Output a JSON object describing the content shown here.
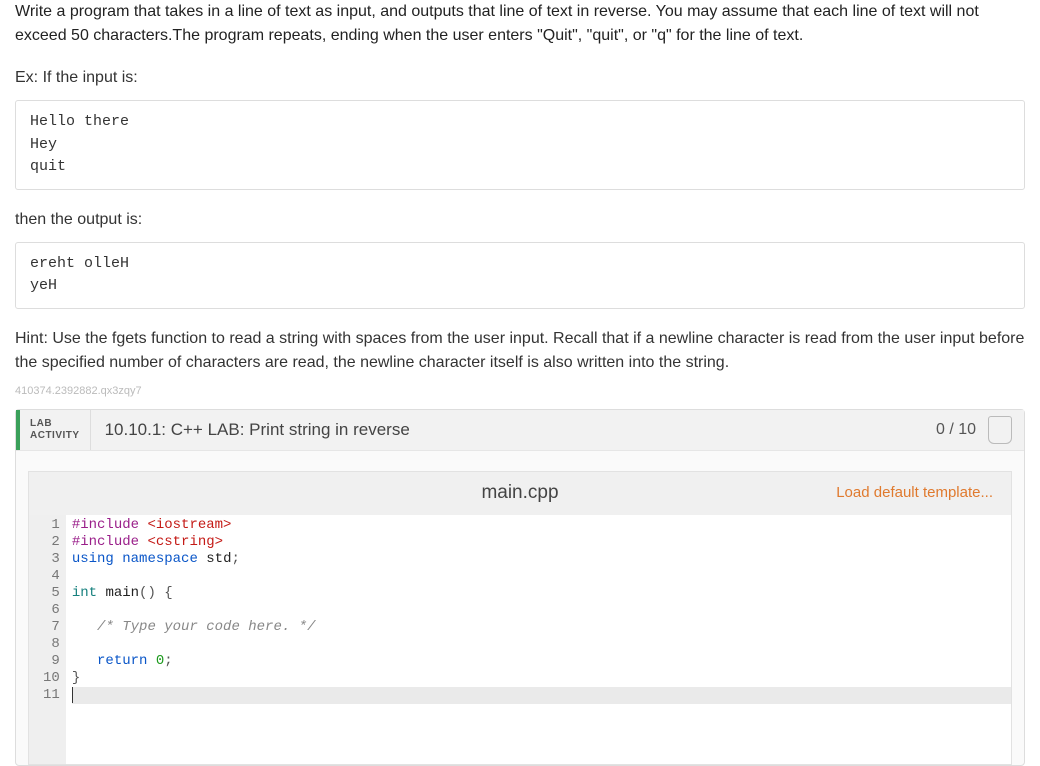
{
  "problem": {
    "description": "Write a program that takes in a line of text as input, and outputs that line of text in reverse. You may assume that each line of text will not exceed 50 characters.The program repeats, ending when the user enters \"Quit\", \"quit\", or \"q\" for the line of text.",
    "ex_label": "Ex: If the input is:",
    "input_example": "Hello there\nHey\nquit",
    "then_label": "then the output is:",
    "output_example": "ereht olleH\nyeH",
    "hint": "Hint: Use the fgets function to read a string with spaces from the user input. Recall that if a newline character is read from the user input before the specified number of characters are read, the newline character itself is also written into the string.",
    "small_id": "410374.2392882.qx3zqy7"
  },
  "lab": {
    "tab_line1": "LAB",
    "tab_line2": "ACTIVITY",
    "title": "10.10.1: C++ LAB: Print string in reverse",
    "score": "0 / 10",
    "filename": "main.cpp",
    "load_default": "Load default template...",
    "code_lines": [
      [
        {
          "t": "pre",
          "v": "#include"
        },
        {
          "t": "plain",
          "v": " "
        },
        {
          "t": "str",
          "v": "<iostream>"
        }
      ],
      [
        {
          "t": "pre",
          "v": "#include"
        },
        {
          "t": "plain",
          "v": " "
        },
        {
          "t": "str",
          "v": "<cstring>"
        }
      ],
      [
        {
          "t": "kw",
          "v": "using"
        },
        {
          "t": "plain",
          "v": " "
        },
        {
          "t": "kw",
          "v": "namespace"
        },
        {
          "t": "plain",
          "v": " "
        },
        {
          "t": "name",
          "v": "std"
        },
        {
          "t": "punct",
          "v": ";"
        }
      ],
      [],
      [
        {
          "t": "type",
          "v": "int"
        },
        {
          "t": "plain",
          "v": " "
        },
        {
          "t": "name",
          "v": "main"
        },
        {
          "t": "punct",
          "v": "()"
        },
        {
          "t": "plain",
          "v": " "
        },
        {
          "t": "punct",
          "v": "{"
        }
      ],
      [],
      [
        {
          "t": "plain",
          "v": "   "
        },
        {
          "t": "comment",
          "v": "/* Type your code here. */"
        }
      ],
      [],
      [
        {
          "t": "plain",
          "v": "   "
        },
        {
          "t": "kw",
          "v": "return"
        },
        {
          "t": "plain",
          "v": " "
        },
        {
          "t": "num",
          "v": "0"
        },
        {
          "t": "punct",
          "v": ";"
        }
      ],
      [
        {
          "t": "punct",
          "v": "}"
        }
      ],
      []
    ]
  }
}
